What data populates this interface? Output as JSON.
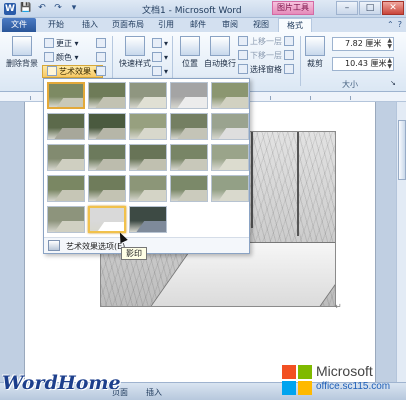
{
  "titlebar": {
    "app_icon": "W",
    "title": "文档1 - Microsoft Word",
    "context_tab": "图片工具",
    "qat_icons": [
      "save-icon",
      "undo-icon",
      "redo-icon"
    ]
  },
  "tabs": [
    "文件",
    "开始",
    "插入",
    "页面布局",
    "引用",
    "邮件",
    "审阅",
    "视图",
    "格式"
  ],
  "ribbon": {
    "remove_bg": "删除背景",
    "corrections": "更正",
    "color": "颜色",
    "art_effects": "艺术效果",
    "quick_styles": "快速样式",
    "position": "位置",
    "wrap_text": "自动换行",
    "bring_forward": "上移一层",
    "send_backward": "下移一层",
    "selection_pane": "选择窗格",
    "crop": "裁剪",
    "height": "7.82 厘米",
    "width": "10.43 厘米",
    "size_group": "大小"
  },
  "gallery": {
    "options_label": "艺术效果选项(E)...",
    "tooltip": "影印",
    "selected_index": 0,
    "hover_index": 21,
    "thumbs": [
      {
        "bg": "#7d8a63",
        "road": "#c9c9b9"
      },
      {
        "bg": "#6e7b58",
        "road": "#c2c2b2"
      },
      {
        "bg": "#8f9680",
        "road": "#e0e0d4"
      },
      {
        "bg": "#a4a4a4",
        "road": "#ececec"
      },
      {
        "bg": "#8b9670",
        "road": "#d1d1c1"
      },
      {
        "bg": "#5c6a4b",
        "road": "#a7a79a"
      },
      {
        "bg": "#4a5a3f",
        "road": "#b6b6a8"
      },
      {
        "bg": "#97a07f",
        "road": "#d8d8cc"
      },
      {
        "bg": "#747f62",
        "road": "#c4c4b7"
      },
      {
        "bg": "#9aa38f",
        "road": "#dedede"
      },
      {
        "bg": "#828b70",
        "road": "#cfcfc1"
      },
      {
        "bg": "#6c7a5c",
        "road": "#bcbcad"
      },
      {
        "bg": "#687457",
        "road": "#c0c0b0"
      },
      {
        "bg": "#788566",
        "road": "#c8c8ba"
      },
      {
        "bg": "#9aa48a",
        "road": "#dcdccf"
      },
      {
        "bg": "#7a8763",
        "road": "#c6c6b6"
      },
      {
        "bg": "#6f7c5b",
        "road": "#c3c3b3"
      },
      {
        "bg": "#8c9678",
        "road": "#d4d4c6"
      },
      {
        "bg": "#7b8969",
        "road": "#cbcbbd"
      },
      {
        "bg": "#93a086",
        "road": "#d9d9cd"
      },
      {
        "bg": "#8d947c",
        "road": "#d0d0c2"
      },
      {
        "bg": "#d9d9d9",
        "road": "#ffffff"
      },
      {
        "bg": "#3d4a44",
        "road": "#7e8a9a"
      }
    ]
  },
  "statusbar": {
    "page": "页面",
    "mode": "插入"
  },
  "watermark": {
    "left": "WordHome",
    "brand": "Microsoft",
    "site": "office.sc115.com"
  },
  "colors": {
    "file_tab": "#2a5699",
    "accent": "#f8c964",
    "ms_red": "#f25022",
    "ms_green": "#7fba00",
    "ms_blue": "#00a4ef",
    "ms_yellow": "#ffb900"
  }
}
